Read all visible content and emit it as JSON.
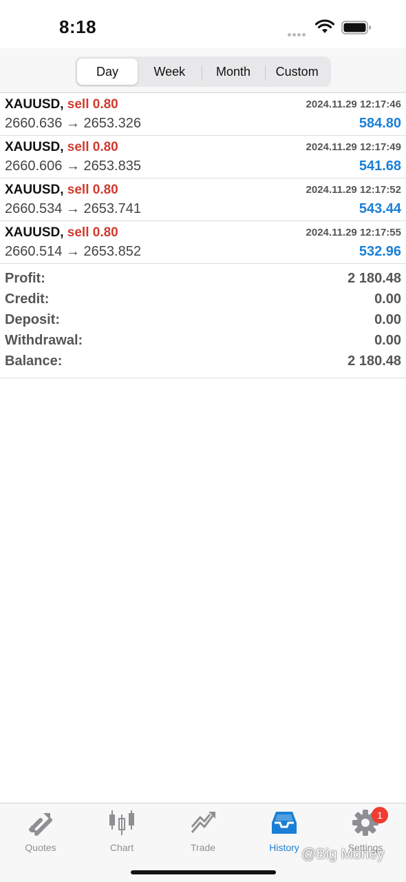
{
  "status": {
    "time": "8:18"
  },
  "segments": [
    {
      "label": "Day",
      "active": true
    },
    {
      "label": "Week",
      "active": false
    },
    {
      "label": "Month",
      "active": false
    },
    {
      "label": "Custom",
      "active": false
    }
  ],
  "deals": [
    {
      "symbol": "XAUUSD,",
      "type": "sell 0.80",
      "datetime": "2024.11.29 12:17:46",
      "prices": "2660.636 → 2653.326",
      "profit": "584.80"
    },
    {
      "symbol": "XAUUSD,",
      "type": "sell 0.80",
      "datetime": "2024.11.29 12:17:49",
      "prices": "2660.606 → 2653.835",
      "profit": "541.68"
    },
    {
      "symbol": "XAUUSD,",
      "type": "sell 0.80",
      "datetime": "2024.11.29 12:17:52",
      "prices": "2660.534 → 2653.741",
      "profit": "543.44"
    },
    {
      "symbol": "XAUUSD,",
      "type": "sell 0.80",
      "datetime": "2024.11.29 12:17:55",
      "prices": "2660.514 → 2653.852",
      "profit": "532.96"
    }
  ],
  "summary": [
    {
      "label": "Profit:",
      "value": "2 180.48"
    },
    {
      "label": "Credit:",
      "value": "0.00"
    },
    {
      "label": "Deposit:",
      "value": "0.00"
    },
    {
      "label": "Withdrawal:",
      "value": "0.00"
    },
    {
      "label": "Balance:",
      "value": "2 180.48"
    }
  ],
  "tabs": [
    {
      "label": "Quotes",
      "icon": "quotes-icon",
      "active": false
    },
    {
      "label": "Chart",
      "icon": "candlestick-chart-icon",
      "active": false
    },
    {
      "label": "Trade",
      "icon": "trade-icon",
      "active": false
    },
    {
      "label": "History",
      "icon": "inbox-history-icon",
      "active": true
    },
    {
      "label": "Settings",
      "icon": "gear-icon",
      "active": false,
      "badge": "1"
    }
  ],
  "watermark": "@Big Money",
  "colors": {
    "accent": "#1a7fd6",
    "sell": "#d03a2f",
    "badge": "#ef3b30"
  }
}
